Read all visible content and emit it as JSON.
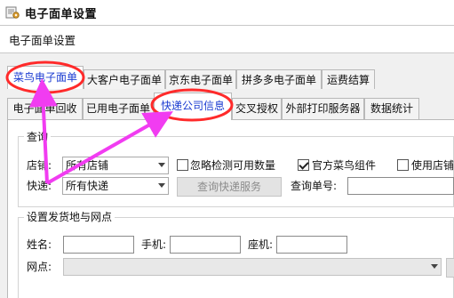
{
  "window": {
    "title": "电子面单设置",
    "icon": "settings-window-icon"
  },
  "header": {
    "text": "电子面单设置"
  },
  "tabs_row1": [
    {
      "label": "菜鸟电子面单",
      "selected": true
    },
    {
      "label": "大客户电子面单",
      "selected": false
    },
    {
      "label": "京东电子面单",
      "selected": false
    },
    {
      "label": "拼多多电子面单",
      "selected": false
    },
    {
      "label": "运费结算",
      "selected": false
    }
  ],
  "tabs_row2": [
    {
      "label": "电子面单回收",
      "selected": false
    },
    {
      "label": "已用电子面单",
      "selected": false
    },
    {
      "label": "快递公司信息",
      "selected": true
    },
    {
      "label": "交叉授权",
      "selected": false
    },
    {
      "label": "外部打印服务器",
      "selected": false
    },
    {
      "label": "数据统计",
      "selected": false
    }
  ],
  "query_group": {
    "title": "查询",
    "shop_label": "店铺:",
    "shop_value": "所有店铺",
    "ignore_check_label": "忽略检测可用数量",
    "ignore_check_checked": false,
    "official_component_label": "官方菜鸟组件",
    "official_component_checked": true,
    "use_shop_label": "使用店铺",
    "use_shop_checked": false,
    "express_label": "快递:",
    "express_value": "所有快递",
    "query_service_button": "查询快递服务",
    "query_number_label": "查询单号:",
    "query_number_value": ""
  },
  "sender_group": {
    "title": "设置发货地与网点",
    "name_label": "姓名:",
    "name_value": "",
    "phone_label": "手机:",
    "phone_value": "",
    "tel_label": "座机:",
    "tel_value": "",
    "outlet_label": "网点:",
    "outlet_value": ""
  },
  "annotations": {
    "highlight_color": "#ff2a2a",
    "arrow_color": "#f13cf1"
  }
}
